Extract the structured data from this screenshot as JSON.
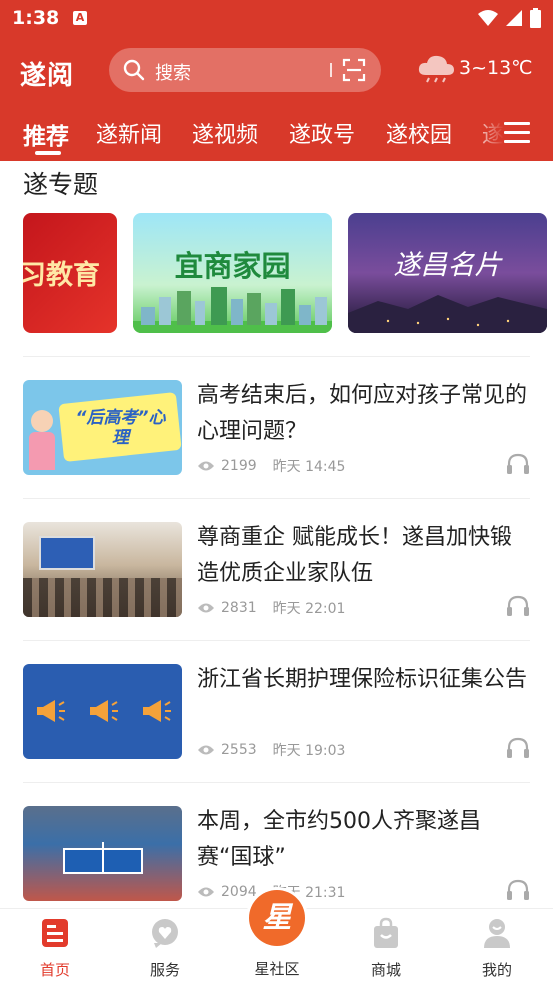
{
  "status_bar": {
    "time": "1:38",
    "notification_glyph": "A"
  },
  "header": {
    "logo": "遂阅",
    "search_placeholder": "搜索",
    "weather": "3~13℃",
    "accent_color": "#d8392a"
  },
  "tabs": [
    "推荐",
    "遂新闻",
    "遂视频",
    "遂政号",
    "遂校园",
    "遂"
  ],
  "section": {
    "title": "遂专题"
  },
  "banners": [
    {
      "text": "习教育"
    },
    {
      "text": "宜商家园"
    },
    {
      "text": "遂昌名片"
    }
  ],
  "news": [
    {
      "title": "高考结束后，如何应对孩子常见的心理问题？",
      "views": "2199",
      "time": "昨天 14:45",
      "thumb_text": "“后高考”心理"
    },
    {
      "title": "尊商重企 赋能成长！遂昌加快锻造优质企业家队伍",
      "views": "2831",
      "time": "昨天 22:01",
      "thumb_text": ""
    },
    {
      "title": "浙江省长期护理保险标识征集公告",
      "views": "2553",
      "time": "昨天 19:03",
      "thumb_text": ""
    },
    {
      "title": "本周，全市约500人齐聚遂昌赛“国球”",
      "views": "2094",
      "time": "昨天 21:31",
      "thumb_text": ""
    }
  ],
  "bottom_nav": {
    "items": [
      "首页",
      "服务",
      "星社区",
      "商城",
      "我的"
    ],
    "center_glyph": "星"
  }
}
